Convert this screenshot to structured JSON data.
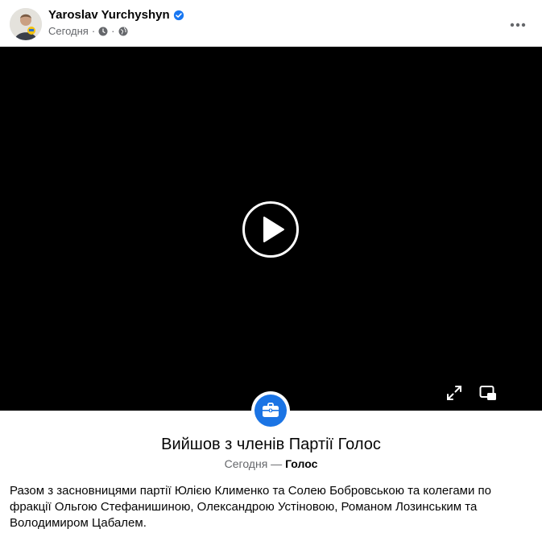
{
  "post": {
    "author": "Yaroslav Yurchyshyn",
    "date": "Сегодня",
    "meta_separator": "·"
  },
  "icons": {
    "verified": "verified-badge-icon",
    "clock": "clock-icon",
    "privacy": "globe-icon",
    "more": "more-options-icon",
    "play": "play-icon",
    "fullscreen": "fullscreen-icon",
    "pip": "picture-in-picture-icon",
    "briefcase": "briefcase-icon"
  },
  "event": {
    "title": "Вийшов з членів Партії Голос",
    "date": "Сегодня",
    "separator": "—",
    "organization": "Голос"
  },
  "body_text": "Разом з засновницями партії Юлією Клименко та Солею Бобровською та колегами по фракції Ольгою Стефанишиною, Олександрою Устіновою, Романом Лозинським та Володимиром Цабалем.",
  "colors": {
    "accent": "#1b74e4",
    "verified": "#1877f2",
    "text_primary": "#050505",
    "text_secondary": "#65676b",
    "video_bg": "#000000"
  }
}
